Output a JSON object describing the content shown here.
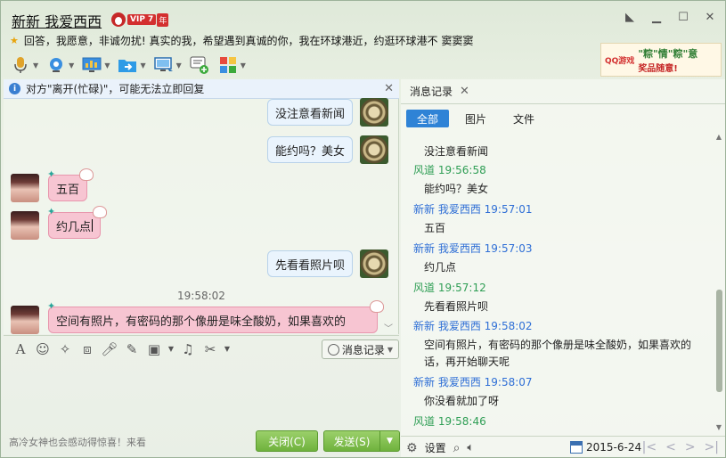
{
  "window": {
    "title": "新新 我爱西西",
    "vip_label": "VIP 7",
    "vip_suffix": "年",
    "signature": "回答，我愿意，非诚勿扰! 真实的我，希望遇到真诚的你，我在环球港近，约逛环球港不 窦窦窦"
  },
  "ad": {
    "brand": "QQ游戏",
    "line1": "\"粽\"情\"粽\"意",
    "line2": "奖品随意!"
  },
  "notice": {
    "text": "对方\"离开(忙碌)\"，可能无法立即回复"
  },
  "chat": {
    "messages": [
      {
        "text": "没注意看新闻"
      },
      {
        "text": "能约吗？美女"
      },
      {
        "text": "五百"
      },
      {
        "text": "约几点"
      },
      {
        "text": "先看看照片呗"
      },
      {
        "text": "空间有照片，有密码的那个像册是味全酸奶，如果喜欢的"
      }
    ],
    "timestamp": "19:58:02"
  },
  "input": {
    "history_button": "消息记录",
    "bottom_signature": "高冷女神也会感动得惊喜！来看",
    "close_label": "关闭(C)",
    "send_label": "发送(S)"
  },
  "history": {
    "tab_label": "消息记录",
    "filters": [
      "全部",
      "图片",
      "文件"
    ],
    "entries": [
      {
        "kind": "body",
        "text": "没注意看新闻"
      },
      {
        "kind": "hdr-g",
        "text": "风道  19:56:58"
      },
      {
        "kind": "body",
        "text": "能约吗？美女"
      },
      {
        "kind": "hdr-b",
        "text": "新新 我爱西西  19:57:01"
      },
      {
        "kind": "body",
        "text": "五百"
      },
      {
        "kind": "hdr-b",
        "text": "新新 我爱西西  19:57:03"
      },
      {
        "kind": "body",
        "text": "约几点"
      },
      {
        "kind": "hdr-g",
        "text": "风道  19:57:12"
      },
      {
        "kind": "body",
        "text": "先看看照片呗"
      },
      {
        "kind": "hdr-b",
        "text": "新新 我爱西西  19:58:02"
      },
      {
        "kind": "body-wrap",
        "text": "空间有照片，有密码的那个像册是味全酸奶，如果喜欢的话，再开始聊天呢"
      },
      {
        "kind": "hdr-b",
        "text": "新新 我爱西西  19:58:07"
      },
      {
        "kind": "body",
        "text": "你没看就加了呀"
      },
      {
        "kind": "hdr-g",
        "text": "风道  19:58:46"
      }
    ],
    "settings_label": "设置",
    "date": "2015-6-24"
  }
}
